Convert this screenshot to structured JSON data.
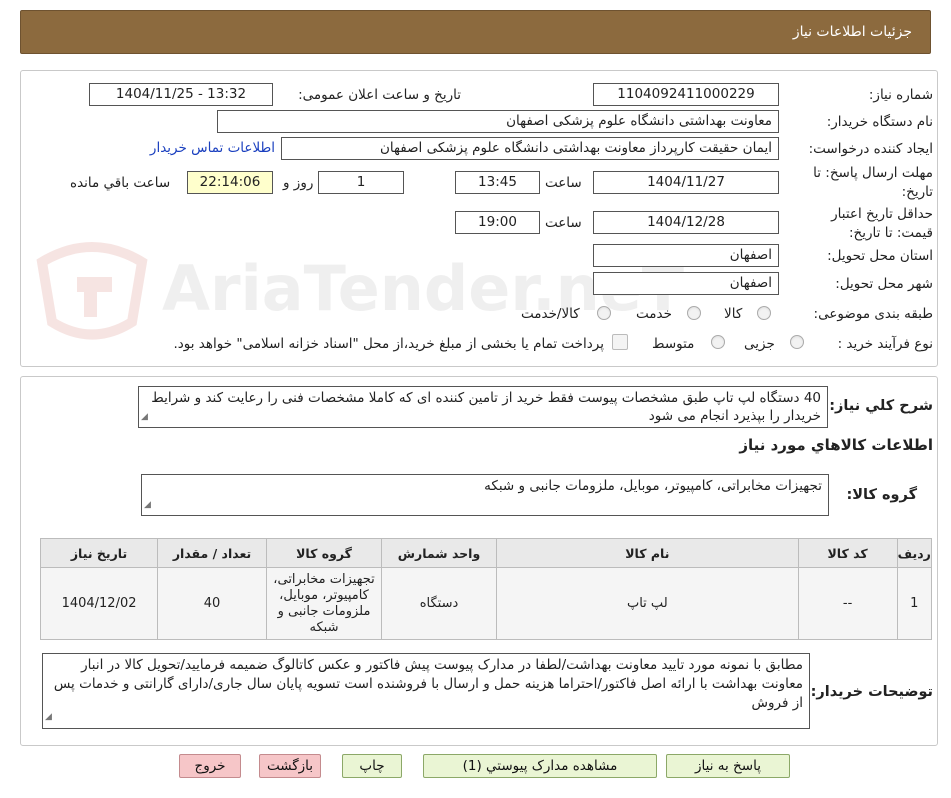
{
  "header": {
    "title": "جزئیات اطلاعات نیاز"
  },
  "labels": {
    "need_number": "شماره نیاز:",
    "announce_datetime": "تاریخ و ساعت اعلان عمومی:",
    "buyer_org": "نام دستگاه خریدار:",
    "requester": "ایجاد کننده درخواست:",
    "contact_link": "اطلاعات تماس خریدار",
    "reply_deadline_line1": "مهلت ارسال پاسخ: تا",
    "reply_deadline_line2": "تاریخ:",
    "time": "ساعت",
    "days_and": "روز و",
    "remaining": "ساعت باقي مانده",
    "min_validity_line1": "حداقل تاریخ اعتبار",
    "min_validity_line2": "قیمت: تا تاریخ:",
    "province": "استان محل تحویل:",
    "city": "شهر محل تحویل:",
    "category": "طبقه بندی موضوعی:",
    "process": "نوع فرآیند خرید :",
    "general_desc": "شرح کلي نياز:",
    "goods_info": "اطلاعات کالاهاي مورد نياز",
    "goods_group": "گروه کالا:",
    "buyer_notes": "توضیحات خریدار:"
  },
  "values": {
    "need_number": "1104092411000229",
    "announce_datetime": "1404/11/25 - 13:32",
    "buyer_org": "معاونت بهداشتی دانشگاه علوم پزشکی اصفهان",
    "requester": "ایمان حقیقت کارپرداز معاونت بهداشتی دانشگاه علوم پزشکی اصفهان",
    "reply_date": "1404/11/27",
    "reply_time": "13:45",
    "days": "1",
    "remaining_time": "22:14:06",
    "validity_date": "1404/12/28",
    "validity_time": "19:00",
    "province": "اصفهان",
    "city": "اصفهان"
  },
  "category_options": [
    {
      "label": "کالا",
      "selected": false
    },
    {
      "label": "خدمت",
      "selected": false
    },
    {
      "label": "کالا/خدمت",
      "selected": false
    }
  ],
  "process_options": [
    {
      "label": "جزیی",
      "selected": false
    },
    {
      "label": "متوسط",
      "selected": false
    }
  ],
  "payment_note": "پرداخت تمام یا بخشی از مبلغ خرید،از محل \"اسناد خزانه اسلامی\" خواهد بود.",
  "general_desc_text": "40 دستگاه لپ تاپ طبق مشخصات پیوست فقط خرید از تامین کننده ای که کاملا مشخصات فنی را رعایت کند و شرایط خریدار را بپذیرد انجام می شود",
  "goods_group_text": "تجهیزات مخابراتی، کامپیوتر، موبایل، ملزومات جانبی و شبکه",
  "table": {
    "headers": [
      "ردیف",
      "کد کالا",
      "نام کالا",
      "واحد شمارش",
      "گروه کالا",
      "تعداد / مقدار",
      "تاریخ نیاز"
    ],
    "rows": [
      [
        "1",
        "--",
        "لپ تاپ",
        "دستگاه",
        "تجهیزات مخابراتی، کامپیوتر، موبایل، ملزومات جانبی و شبکه",
        "40",
        "1404/12/02"
      ]
    ]
  },
  "buyer_notes_text": "مطابق با نمونه مورد تایید معاونت بهداشت/لطفا در مدارک پیوست پیش فاکتور و عکس کاتالوگ  ضمیمه فرمایید/تحویل کالا در انبار معاونت بهداشت با ارائه اصل فاکتور/احتراما هزینه حمل و ارسال با فروشنده است تسویه پایان سال جاری/دارای گارانتی و خدمات پس از فروش",
  "buttons": {
    "reply": "پاسخ به نیاز",
    "attachments": "مشاهده مدارک پیوستي (1)",
    "print": "چاپ",
    "back": "بازگشت",
    "exit": "خروج"
  },
  "watermark": {
    "text": "AriaTender.neT"
  },
  "colors": {
    "header_bg": "#8c6a3e",
    "button_green": "#eaf5d4",
    "button_pink": "#f6c6c8",
    "highlight": "#ffffcc",
    "link": "#1a3fbf"
  }
}
